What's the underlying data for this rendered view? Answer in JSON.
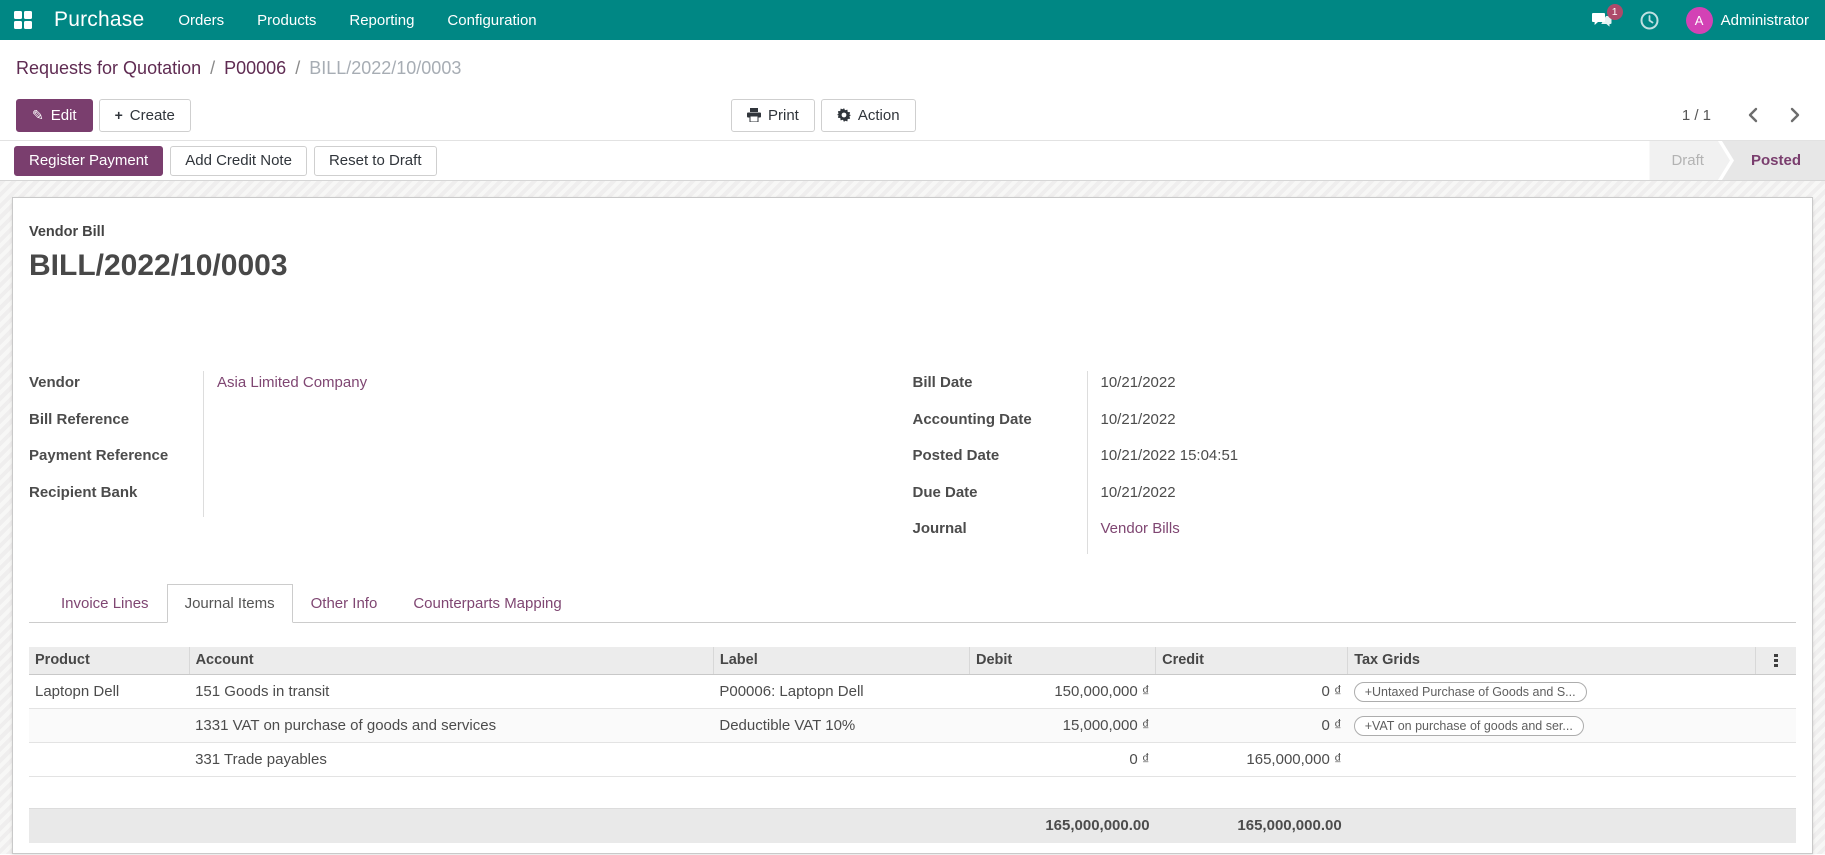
{
  "colors": {
    "topbar_bg": "#008784",
    "primary": "#7a3e6e",
    "link": "#7f4672",
    "breadcrumb_link": "#5f2b52",
    "avatar_bg": "#d342b5",
    "badge_bg": "#ad4a6a",
    "text": "#4c4c4c"
  },
  "topbar": {
    "app_name": "Purchase",
    "menus": [
      "Orders",
      "Products",
      "Reporting",
      "Configuration"
    ],
    "messages_badge": "1",
    "avatar_initial": "A",
    "user": "Administrator"
  },
  "breadcrumb": {
    "items": [
      "Requests for Quotation",
      "P00006"
    ],
    "current": "BILL/2022/10/0003"
  },
  "control_panel": {
    "edit_label": "Edit",
    "create_label": "Create",
    "print_label": "Print",
    "action_label": "Action",
    "pager": "1 / 1"
  },
  "statusbar": {
    "buttons": [
      "Register Payment",
      "Add Credit Note",
      "Reset to Draft"
    ],
    "states": [
      {
        "label": "Draft",
        "active": false
      },
      {
        "label": "Posted",
        "active": true
      }
    ]
  },
  "document": {
    "type_label": "Vendor Bill",
    "title": "BILL/2022/10/0003"
  },
  "fields_left": [
    {
      "label": "Vendor",
      "value": "Asia Limited Company"
    },
    {
      "label": "Bill Reference",
      "value": ""
    },
    {
      "label": "Payment Reference",
      "value": ""
    },
    {
      "label": "Recipient Bank",
      "value": ""
    }
  ],
  "fields_right": [
    {
      "label": "Bill Date",
      "value": "10/21/2022"
    },
    {
      "label": "Accounting Date",
      "value": "10/21/2022"
    },
    {
      "label": "Posted Date",
      "value": "10/21/2022 15:04:51"
    },
    {
      "label": "Due Date",
      "value": "10/21/2022"
    },
    {
      "label": "Journal",
      "value": "Vendor Bills"
    }
  ],
  "tabs": [
    {
      "label": "Invoice Lines",
      "active": false
    },
    {
      "label": "Journal Items",
      "active": true
    },
    {
      "label": "Other Info",
      "active": false
    },
    {
      "label": "Counterparts Mapping",
      "active": false
    }
  ],
  "journal_items": {
    "columns": [
      "Product",
      "Account",
      "Label",
      "Debit",
      "Credit",
      "Tax Grids"
    ],
    "rows": [
      {
        "product": "Laptopn Dell",
        "account": "151 Goods in transit",
        "label": "P00006: Laptopn Dell",
        "debit": "150,000,000 ₫",
        "credit": "0 ₫",
        "tax_grids": "+Untaxed Purchase of Goods and S..."
      },
      {
        "product": "",
        "account": "1331 VAT on purchase of goods and services",
        "label": "Deductible VAT 10%",
        "debit": "15,000,000 ₫",
        "credit": "0 ₫",
        "tax_grids": "+VAT on purchase of goods and ser..."
      },
      {
        "product": "",
        "account": "331 Trade payables",
        "label": "",
        "debit": "0 ₫",
        "credit": "165,000,000 ₫",
        "tax_grids": ""
      }
    ],
    "totals": {
      "debit": "165,000,000.00",
      "credit": "165,000,000.00"
    }
  }
}
